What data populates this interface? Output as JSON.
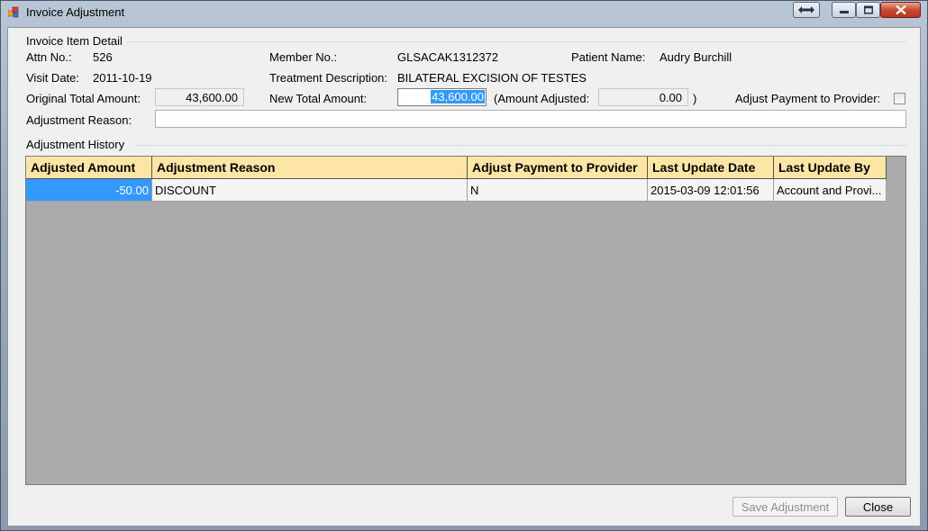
{
  "window": {
    "title": "Invoice Adjustment"
  },
  "detail": {
    "group_title": "Invoice Item Detail",
    "attn_label": "Attn No.:",
    "attn_value": "526",
    "member_label": "Member No.:",
    "member_value": "GLSACAK1312372",
    "patient_label": "Patient Name:",
    "patient_value": "Audry Burchill",
    "visit_label": "Visit Date:",
    "visit_value": "2011-10-19",
    "treatment_label": "Treatment Description:",
    "treatment_value": "BILATERAL EXCISION OF TESTES",
    "orig_label": "Original Total Amount:",
    "orig_value": "43,600.00",
    "new_label": "New Total Amount:",
    "new_value": "43,600.00",
    "adj_label": "(Amount Adjusted:",
    "adj_value": "0.00",
    "adj_close": ")",
    "adjust_provider_label": "Adjust Payment to Provider:",
    "adjust_provider_checked": false,
    "reason_label": "Adjustment Reason:",
    "reason_value": ""
  },
  "history": {
    "group_title": "Adjustment History",
    "columns": [
      "Adjusted Amount",
      "Adjustment Reason",
      "Adjust Payment to Provider",
      "Last Update Date",
      "Last Update By"
    ],
    "rows": [
      [
        "-50.00",
        "DISCOUNT",
        "N",
        "2015-03-09 12:01:56",
        "Account and Provi..."
      ]
    ]
  },
  "buttons": {
    "save": "Save Adjustment",
    "close": "Close"
  },
  "colors": {
    "header_bg": "#fde5a5",
    "selection": "#3399ff",
    "grid_bg": "#ababab"
  }
}
